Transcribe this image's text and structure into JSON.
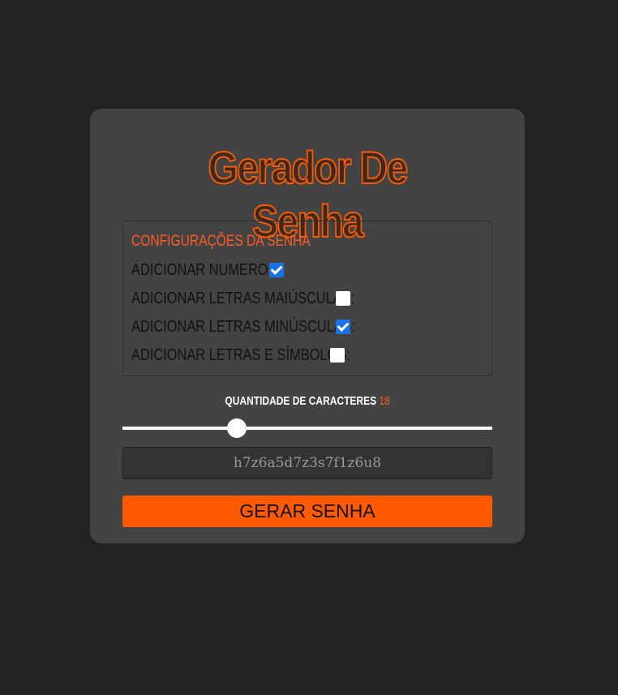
{
  "app": {
    "title": "Gerador De Senha"
  },
  "config": {
    "heading": "CONFIGURAÇÕES DA SENHA",
    "options": [
      {
        "label": "ADICIONAR NUMEROS:",
        "checked": true
      },
      {
        "label": "ADICIONAR LETRAS MAIÚSCULAS:",
        "checked": false
      },
      {
        "label": "ADICIONAR LETRAS MINÚSCULAS:",
        "checked": true
      },
      {
        "label": "ADICIONAR LETRAS E SÍMBOLOS:",
        "checked": false
      }
    ]
  },
  "length": {
    "label": "QUANTIDADE DE CARACTERES",
    "value": "18",
    "slider_fraction": 0.31
  },
  "output": {
    "password": "h7z6a5d7z3s7f1z6u8"
  },
  "generate_button": {
    "label": "GERAR SENHA"
  },
  "colors": {
    "page_background": "#222222",
    "card_background": "#434343",
    "accent": "#ff5a00",
    "checkbox_checked": "#1a73e8"
  }
}
